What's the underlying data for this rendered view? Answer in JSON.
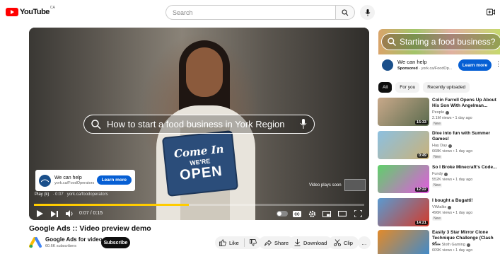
{
  "header": {
    "logo_text": "YouTube",
    "logo_region": "CA",
    "search_placeholder": "Search"
  },
  "player": {
    "overlay_search_text": "How to start a food business in York Region",
    "sign": {
      "line1": "Come In",
      "line2": "WE'RE",
      "line3": "OPEN"
    },
    "ad_card": {
      "title": "We can help",
      "subtitle": "york.ca/FoodOperators",
      "learn_more": "Learn more"
    },
    "ad_info": {
      "play": "Play (k)",
      "label": "· 0:07",
      "url": "york.ca/foodoperators"
    },
    "plays_soon": "Video plays soon",
    "time": "0:07 / 0:15",
    "progress": 0.47
  },
  "video": {
    "title": "Google Ads :: Video preview demo",
    "channel": "Google Ads for video",
    "subscribers": "60.6K subscribers",
    "subscribe": "Subscribe",
    "like": "Like",
    "share": "Share",
    "download": "Download",
    "clip": "Clip",
    "more": "…"
  },
  "sidebar": {
    "promo_text": "Starting a food business?",
    "sponsor": {
      "title": "We can help",
      "sponsored": "Sponsored",
      "url": "· york.ca/FoodOp...",
      "learn_more": "Learn more"
    },
    "chips": [
      "All",
      "For you",
      "Recently uploaded"
    ],
    "recommendations": [
      {
        "title": "Colin Farrell Opens Up About His Son With Angelman...",
        "channel": "People",
        "meta": "2.1M views • 1 day ago",
        "badge": "New",
        "duration": "15:33",
        "colors": [
          "#c9a98a",
          "#5a6b4e"
        ]
      },
      {
        "title": "Dive into fun with Summer Games!",
        "channel": "Hay Day",
        "meta": "668K views • 1 day ago",
        "badge": "New",
        "duration": "0:49",
        "colors": [
          "#8cc0e0",
          "#c9b27a"
        ]
      },
      {
        "title": "So I Broke Minecraft's Code...",
        "channel": "Fundy",
        "meta": "552K views • 1 day ago",
        "badge": "New",
        "duration": "12:22",
        "colors": [
          "#5fd06a",
          "#e25adf"
        ]
      },
      {
        "title": "I bought a Bugatti!",
        "channel": "VWtalks",
        "meta": "496K views • 1 day ago",
        "badge": "New",
        "duration": "14:21",
        "colors": [
          "#5a9ad0",
          "#d33a2a"
        ]
      },
      {
        "title": "Easily 3 Star Mirror Clone Technique Challenge (Clash of...",
        "channel": "Judo Sloth Gaming",
        "meta": "609K views • 1 day ago",
        "badge": "",
        "duration": "",
        "colors": [
          "#e28a2a",
          "#3a8ad0"
        ]
      }
    ]
  }
}
